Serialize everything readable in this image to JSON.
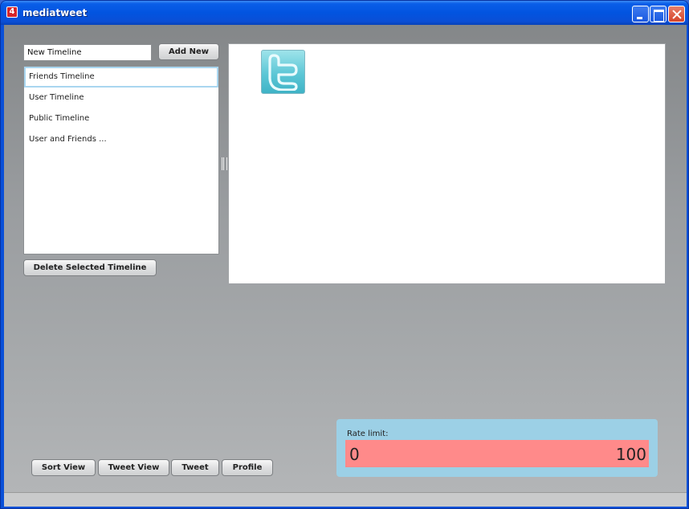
{
  "window": {
    "app_icon_glyph": "4",
    "title": "mediatweet"
  },
  "timeline_form": {
    "input_value": "New Timeline",
    "add_button": "Add New",
    "delete_button": "Delete Selected Timeline"
  },
  "timelines": [
    {
      "label": "Friends Timeline",
      "selected": true
    },
    {
      "label": "User Timeline",
      "selected": false
    },
    {
      "label": "Public Timeline",
      "selected": false
    },
    {
      "label": "User and Friends ...",
      "selected": false
    }
  ],
  "content": {
    "logo_icon": "twitter-bird-icon"
  },
  "bottom_toolbar": {
    "sort_view": "Sort View",
    "tweet_view": "Tweet View",
    "tweet": "Tweet",
    "profile": "Profile"
  },
  "rate_limit": {
    "label": "Rate limit:",
    "min": "0",
    "max": "100",
    "fraction": 1.0
  },
  "colors": {
    "rate_fill": "#ff8a8a",
    "rate_panel": "#9cd0e6",
    "selected_border": "#a9d6f0"
  }
}
